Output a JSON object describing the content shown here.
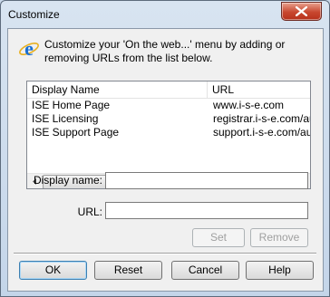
{
  "window": {
    "title": "Customize",
    "instructions": "Customize your 'On the web...' menu by adding or removing URLs from the list below."
  },
  "list": {
    "columns": [
      "Display Name",
      "URL"
    ],
    "rows": [
      {
        "name": "ISE Home Page",
        "url": "www.i-s-e.com"
      },
      {
        "name": "ISE Licensing",
        "url": "registrar.i-s-e.com/au"
      },
      {
        "name": "ISE Support Page",
        "url": "support.i-s-e.com/au"
      }
    ]
  },
  "form": {
    "display_name_label": "Display name:",
    "display_name_value": "",
    "url_label": "URL:",
    "url_value": ""
  },
  "buttons": {
    "set": "Set",
    "remove": "Remove",
    "ok": "OK",
    "reset": "Reset",
    "cancel": "Cancel",
    "help": "Help"
  }
}
